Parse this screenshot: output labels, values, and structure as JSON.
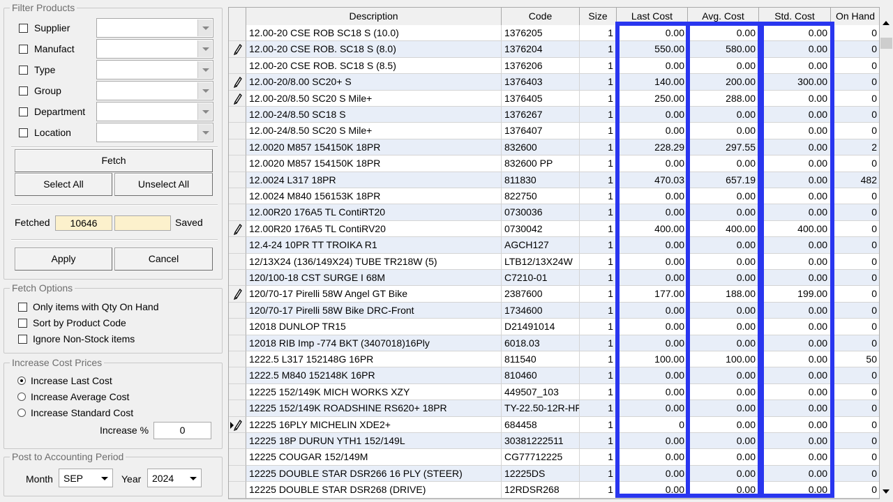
{
  "filter_products": {
    "title": "Filter Products",
    "filters": [
      {
        "label": "Supplier",
        "value": ""
      },
      {
        "label": "Manufact",
        "value": ""
      },
      {
        "label": "Type",
        "value": ""
      },
      {
        "label": "Group",
        "value": ""
      },
      {
        "label": "Department",
        "value": ""
      },
      {
        "label": "Location",
        "value": ""
      }
    ],
    "fetch_label": "Fetch",
    "select_all_label": "Select All",
    "unselect_all_label": "Unselect All",
    "fetched_label": "Fetched",
    "fetched_count": "10646",
    "saved_value": "",
    "saved_label": "Saved",
    "apply_label": "Apply",
    "cancel_label": "Cancel"
  },
  "fetch_options": {
    "title": "Fetch Options",
    "options": [
      {
        "label": "Only items with Qty On Hand",
        "checked": false
      },
      {
        "label": "Sort by Product Code",
        "checked": false
      },
      {
        "label": "Ignore Non-Stock items",
        "checked": false
      }
    ]
  },
  "increase_cost": {
    "title": "Increase Cost Prices",
    "options": [
      {
        "label": "Increase Last Cost",
        "selected": true
      },
      {
        "label": "Increase Average Cost",
        "selected": false
      },
      {
        "label": "Increase Standard Cost",
        "selected": false
      }
    ],
    "percent_label": "Increase %",
    "percent_value": "0"
  },
  "post_period": {
    "title": "Post to Accounting Period",
    "month_label": "Month",
    "month_value": "SEP",
    "year_label": "Year",
    "year_value": "2024"
  },
  "grid": {
    "columns": [
      "Description",
      "Code",
      "Size",
      "Last Cost",
      "Avg. Cost",
      "Std. Cost",
      "On Hand"
    ],
    "rows": [
      {
        "marker": "",
        "desc": "12.00-20 CSE ROB SC18 S (10.0)",
        "code": "1376205",
        "size": "1",
        "last": "0.00",
        "avg": "0.00",
        "std": "0.00",
        "onhand": "0"
      },
      {
        "marker": "pencil",
        "desc": "12.00-20 CSE ROB. SC18 S (8.0)",
        "code": "1376204",
        "size": "1",
        "last": "550.00",
        "avg": "580.00",
        "std": "0.00",
        "onhand": "0"
      },
      {
        "marker": "",
        "desc": "12.00-20 CSE ROB. SC18 S (8.5)",
        "code": "1376206",
        "size": "1",
        "last": "0.00",
        "avg": "0.00",
        "std": "0.00",
        "onhand": "0"
      },
      {
        "marker": "pencil",
        "desc": "12.00-20/8.00 SC20+ S",
        "code": "1376403",
        "size": "1",
        "last": "140.00",
        "avg": "200.00",
        "std": "300.00",
        "onhand": "0"
      },
      {
        "marker": "pencil",
        "desc": "12.00-20/8.50 SC20 S Mile+",
        "code": "1376405",
        "size": "1",
        "last": "250.00",
        "avg": "288.00",
        "std": "0.00",
        "onhand": "0"
      },
      {
        "marker": "",
        "desc": "12.00-24/8.50 SC18 S",
        "code": "1376267",
        "size": "1",
        "last": "0.00",
        "avg": "0.00",
        "std": "0.00",
        "onhand": "0"
      },
      {
        "marker": "",
        "desc": "12.00-24/8.50 SC20 S Mile+",
        "code": "1376407",
        "size": "1",
        "last": "0.00",
        "avg": "0.00",
        "std": "0.00",
        "onhand": "0"
      },
      {
        "marker": "",
        "desc": "12.0020 M857 154150K 18PR",
        "code": "832600",
        "size": "1",
        "last": "228.29",
        "avg": "297.55",
        "std": "0.00",
        "onhand": "2"
      },
      {
        "marker": "",
        "desc": "12.0020 M857 154150K 18PR",
        "code": "832600 PP",
        "size": "1",
        "last": "0.00",
        "avg": "0.00",
        "std": "0.00",
        "onhand": "0"
      },
      {
        "marker": "",
        "desc": "12.0024 L317 18PR",
        "code": "811830",
        "size": "1",
        "last": "470.03",
        "avg": "657.19",
        "std": "0.00",
        "onhand": "482"
      },
      {
        "marker": "",
        "desc": "12.0024 M840 156153K 18PR",
        "code": "822750",
        "size": "1",
        "last": "0.00",
        "avg": "0.00",
        "std": "0.00",
        "onhand": "0"
      },
      {
        "marker": "",
        "desc": "12.00R20 176A5 TL ContiRT20",
        "code": "0730036",
        "size": "1",
        "last": "0.00",
        "avg": "0.00",
        "std": "0.00",
        "onhand": "0"
      },
      {
        "marker": "pencil",
        "desc": "12.00R20 176A5 TL ContiRV20",
        "code": "0730042",
        "size": "1",
        "last": "400.00",
        "avg": "400.00",
        "std": "400.00",
        "onhand": "0"
      },
      {
        "marker": "",
        "desc": "12.4-24 10PR TT TROIKA R1",
        "code": "AGCH127",
        "size": "1",
        "last": "0.00",
        "avg": "0.00",
        "std": "0.00",
        "onhand": "0"
      },
      {
        "marker": "",
        "desc": "12/13X24 (136/149X24) TUBE TR218W (5)",
        "code": "LTB12/13X24W",
        "size": "1",
        "last": "0.00",
        "avg": "0.00",
        "std": "0.00",
        "onhand": "0"
      },
      {
        "marker": "",
        "desc": "120/100-18 CST SURGE I 68M",
        "code": "C7210-01",
        "size": "1",
        "last": "0.00",
        "avg": "0.00",
        "std": "0.00",
        "onhand": "0"
      },
      {
        "marker": "pencil",
        "desc": "120/70-17 Pirelli 58W Angel GT Bike",
        "code": "2387600",
        "size": "1",
        "last": "177.00",
        "avg": "188.00",
        "std": "199.00",
        "onhand": "0"
      },
      {
        "marker": "",
        "desc": "120/70-17 Pirelli 58W Bike DRC-Front",
        "code": "1734600",
        "size": "1",
        "last": "0.00",
        "avg": "0.00",
        "std": "0.00",
        "onhand": "0"
      },
      {
        "marker": "",
        "desc": "12018 DUNLOP TR15",
        "code": "D21491014",
        "size": "1",
        "last": "0.00",
        "avg": "0.00",
        "std": "0.00",
        "onhand": "0"
      },
      {
        "marker": "",
        "desc": "12018 RIB Imp -774 BKT (3407018)16Ply",
        "code": "6018.03",
        "size": "1",
        "last": "0.00",
        "avg": "0.00",
        "std": "0.00",
        "onhand": "0"
      },
      {
        "marker": "",
        "desc": "1222.5 L317 152148G 16PR",
        "code": "811540",
        "size": "1",
        "last": "100.00",
        "avg": "100.00",
        "std": "0.00",
        "onhand": "50"
      },
      {
        "marker": "",
        "desc": "1222.5 M840 152148K 16PR",
        "code": "810460",
        "size": "1",
        "last": "0.00",
        "avg": "0.00",
        "std": "0.00",
        "onhand": "0"
      },
      {
        "marker": "",
        "desc": "12225 152/149K MICH WORKS XZY",
        "code": "449507_103",
        "size": "1",
        "last": "0.00",
        "avg": "0.00",
        "std": "0.00",
        "onhand": "0"
      },
      {
        "marker": "",
        "desc": "12225 152/149K ROADSHINE RS620+ 18PR",
        "code": "TY-22.50-12R-HF",
        "size": "1",
        "last": "0.00",
        "avg": "0.00",
        "std": "0.00",
        "onhand": "0"
      },
      {
        "marker": "pointer-pencil",
        "desc": "12225 16PLY MICHELIN XDE2+",
        "code": "684458",
        "size": "1",
        "last": "0",
        "avg": "0.00",
        "std": "0.00",
        "onhand": "0"
      },
      {
        "marker": "",
        "desc": "12225 18P DURUN YTH1 152/149L",
        "code": "30381222511",
        "size": "1",
        "last": "0.00",
        "avg": "0.00",
        "std": "0.00",
        "onhand": "0"
      },
      {
        "marker": "",
        "desc": "12225 COUGAR 152/149M",
        "code": "CG77712225",
        "size": "1",
        "last": "0.00",
        "avg": "0.00",
        "std": "0.00",
        "onhand": "0"
      },
      {
        "marker": "",
        "desc": "12225 DOUBLE STAR DSR266 16 PLY (STEER)",
        "code": "12225DS",
        "size": "1",
        "last": "0.00",
        "avg": "0.00",
        "std": "0.00",
        "onhand": "0"
      },
      {
        "marker": "",
        "desc": "12225 DOUBLE STAR DSR268 (DRIVE)",
        "code": "12RDSR268",
        "size": "1",
        "last": "0.00",
        "avg": "0.00",
        "std": "0.00",
        "onhand": "0"
      }
    ]
  },
  "highlight_color": "#2936ef",
  "alt_row_color": "#e8eef8"
}
